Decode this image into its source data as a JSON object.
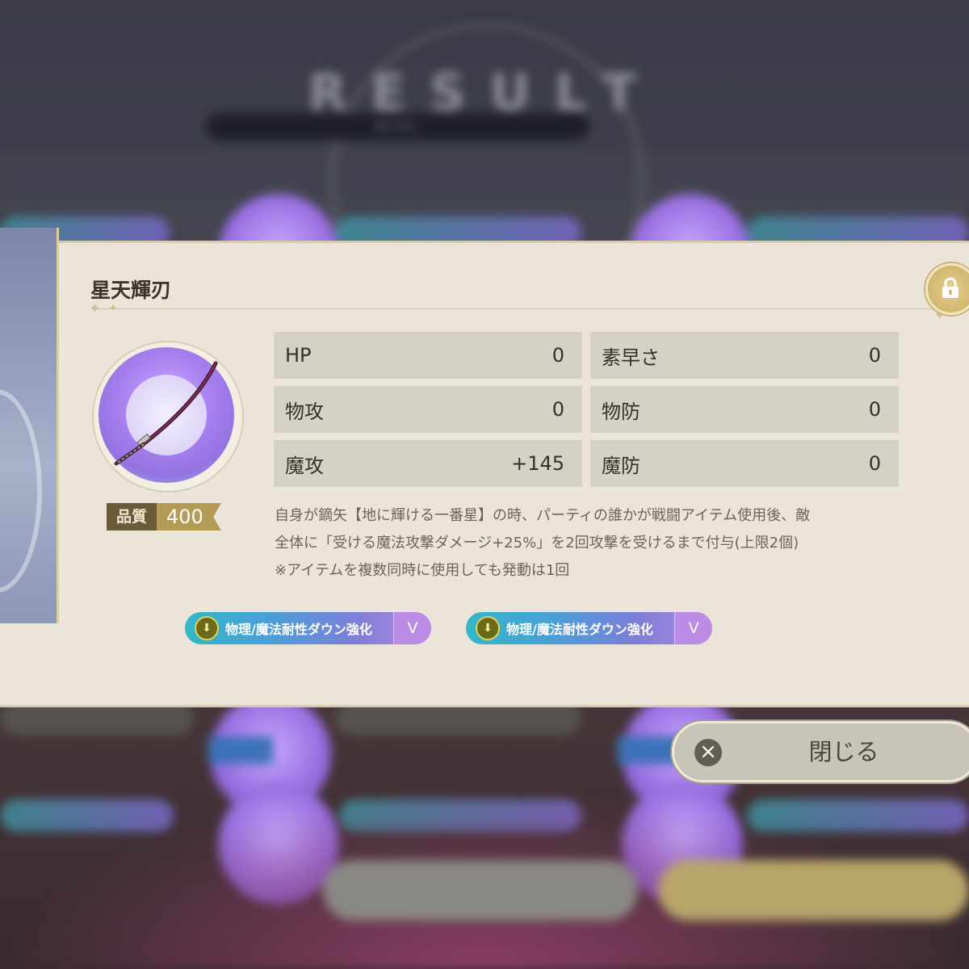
{
  "background": {
    "result_title": "RESULT",
    "result_subtitle": "取り出し"
  },
  "item": {
    "name": "星天輝刃",
    "icon": "sword-icon",
    "quality_label": "品質",
    "quality_value": "400"
  },
  "stats": [
    {
      "label": "HP",
      "value": "0"
    },
    {
      "label": "素早さ",
      "value": "0"
    },
    {
      "label": "物攻",
      "value": "0"
    },
    {
      "label": "物防",
      "value": "0"
    },
    {
      "label": "魔攻",
      "value": "+145"
    },
    {
      "label": "魔防",
      "value": "0"
    }
  ],
  "description": [
    "自身が鏑矢【地に輝ける一番星】の時、パーティの誰かが戦闘アイテム使用後、敵",
    "全体に「受ける魔法攻撃ダメージ+25%」を2回攻撃を受けるまで付与(上限2個)",
    "※アイテムを複数同時に使用しても発動は1回"
  ],
  "skills": [
    {
      "label": "物理/魔法耐性ダウン強化",
      "level": "V",
      "icon": "arrow-down-icon"
    },
    {
      "label": "物理/魔法耐性ダウン強化",
      "level": "V",
      "icon": "arrow-down-icon"
    }
  ],
  "buttons": {
    "close_label": "閉じる",
    "lock_icon": "lock-icon"
  },
  "colors": {
    "panel": "#ebe5d9",
    "stat_cell": "#d5d1c7",
    "quality_gold": "#b39a55"
  }
}
